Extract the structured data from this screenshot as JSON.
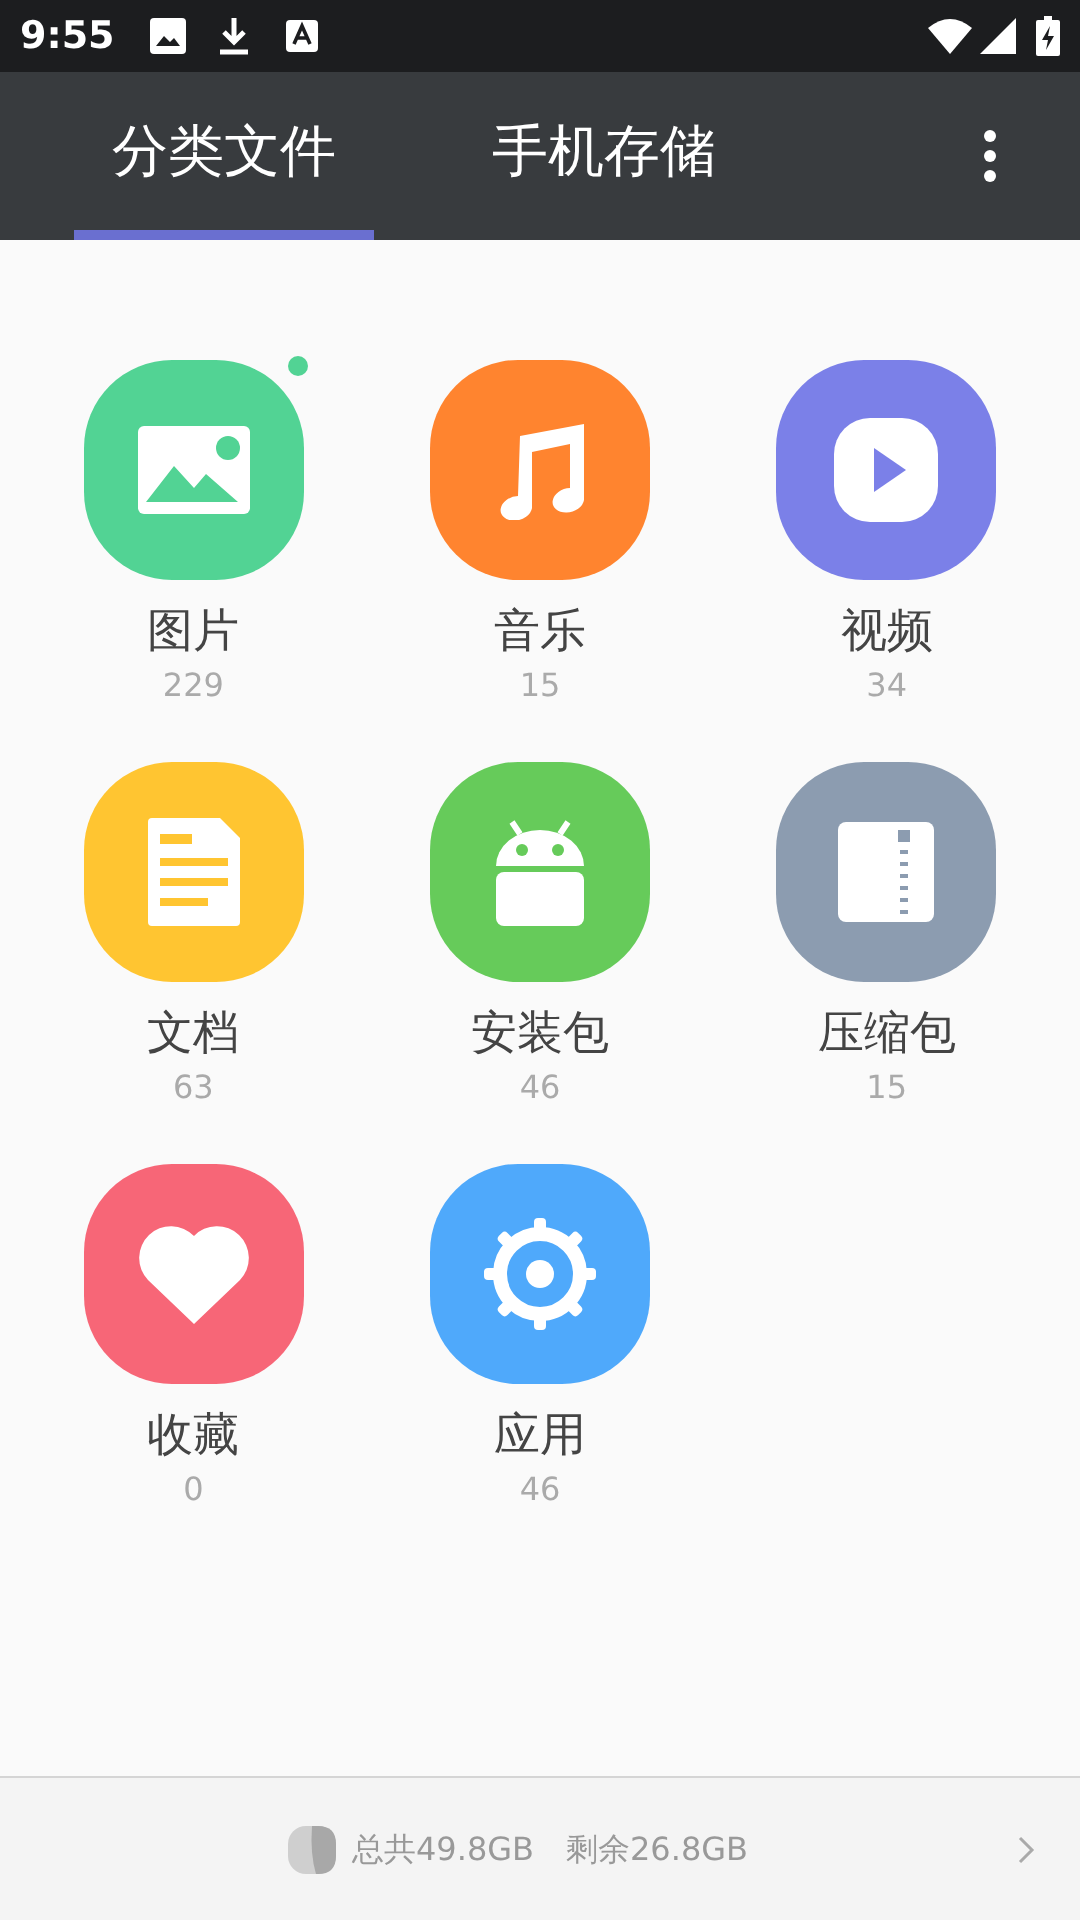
{
  "status_bar": {
    "time": "9:55"
  },
  "tabs": [
    {
      "label": "分类文件",
      "selected": true
    },
    {
      "label": "手机存储",
      "selected": false
    }
  ],
  "categories": [
    {
      "kind": "image",
      "label": "图片",
      "count": "229",
      "color": "#52d394",
      "new": true
    },
    {
      "kind": "music",
      "label": "音乐",
      "count": "15",
      "color": "#ff842f",
      "new": false
    },
    {
      "kind": "video",
      "label": "视频",
      "count": "34",
      "color": "#7b80e8",
      "new": false
    },
    {
      "kind": "document",
      "label": "文档",
      "count": "63",
      "color": "#ffc531",
      "new": false
    },
    {
      "kind": "apk",
      "label": "安装包",
      "count": "46",
      "color": "#66cb5a",
      "new": false
    },
    {
      "kind": "archive",
      "label": "压缩包",
      "count": "15",
      "color": "#8c9cb0",
      "new": false
    },
    {
      "kind": "favorite",
      "label": "收藏",
      "count": "0",
      "color": "#f76677",
      "new": false
    },
    {
      "kind": "app",
      "label": "应用",
      "count": "46",
      "color": "#4fa9fb",
      "new": false
    }
  ],
  "storage": {
    "total": "总共49.8GB",
    "free": "剩余26.8GB"
  }
}
